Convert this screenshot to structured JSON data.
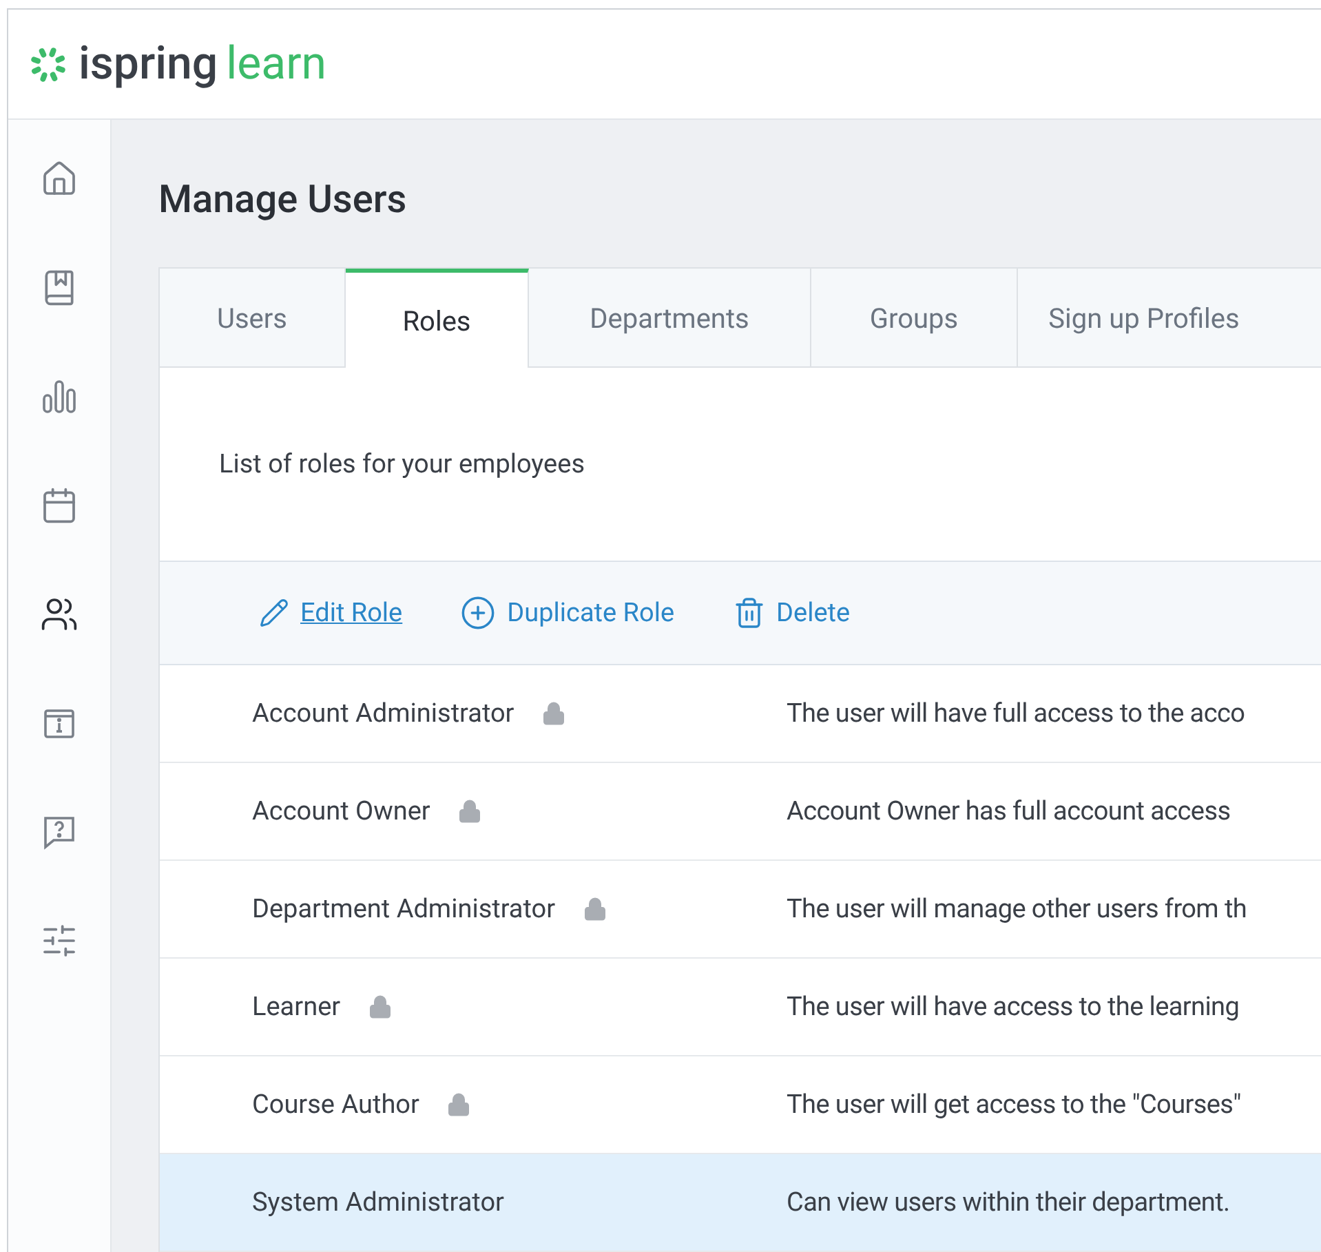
{
  "logo": {
    "primary": "ispring",
    "secondary": "learn"
  },
  "sidebar": {
    "items": [
      {
        "kind": "home",
        "selected": false
      },
      {
        "kind": "book",
        "selected": false
      },
      {
        "kind": "chart",
        "selected": false
      },
      {
        "kind": "calendar",
        "selected": false
      },
      {
        "kind": "users",
        "selected": true
      },
      {
        "kind": "info",
        "selected": false
      },
      {
        "kind": "help",
        "selected": false
      },
      {
        "kind": "settings",
        "selected": false
      }
    ]
  },
  "page": {
    "title": "Manage Users"
  },
  "tabs": [
    {
      "label": "Users",
      "selected": false
    },
    {
      "label": "Roles",
      "selected": true
    },
    {
      "label": "Departments",
      "selected": false
    },
    {
      "label": "Groups",
      "selected": false
    },
    {
      "label": "Sign up Profiles",
      "selected": false
    }
  ],
  "description": "List of roles for your employees",
  "toolbar": [
    {
      "kind": "edit",
      "label": "Edit Role",
      "hovered": true
    },
    {
      "kind": "duplicate",
      "label": "Duplicate Role",
      "hovered": false
    },
    {
      "kind": "delete",
      "label": "Delete",
      "hovered": false
    }
  ],
  "roles": [
    {
      "name": "Account Administrator",
      "locked": true,
      "description": "The user will have full access to the acco",
      "selected": false
    },
    {
      "name": "Account Owner",
      "locked": true,
      "description": "Account Owner has full account access",
      "selected": false
    },
    {
      "name": "Department Administrator",
      "locked": true,
      "description": "The user will manage other users from th",
      "selected": false
    },
    {
      "name": "Learner",
      "locked": true,
      "description": "The user will have access to the learning",
      "selected": false
    },
    {
      "name": "Course Author",
      "locked": true,
      "description": "The user will get access to the \"Courses\"",
      "selected": false
    },
    {
      "name": "System Administrator",
      "locked": false,
      "description": "Can view users within their department.",
      "selected": true
    }
  ]
}
